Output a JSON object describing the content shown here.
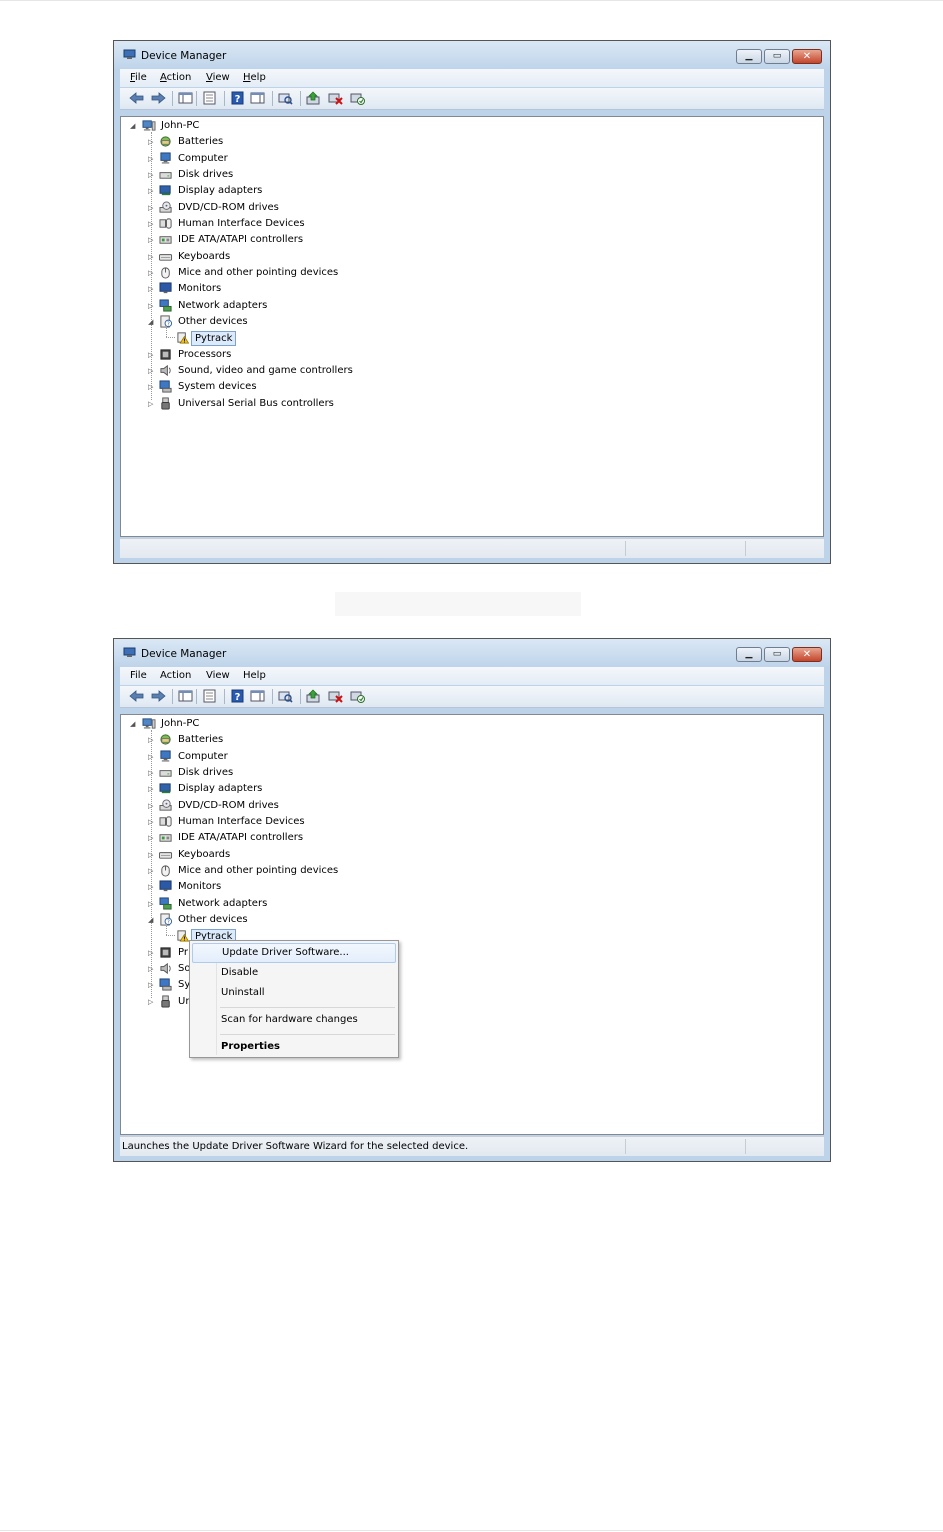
{
  "app": {
    "title": "Device Manager"
  },
  "menu": [
    {
      "label": "File",
      "hotkey": "F",
      "rest": "ile"
    },
    {
      "label": "Action",
      "hotkey": "A",
      "rest": "ction"
    },
    {
      "label": "View",
      "hotkey": "V",
      "rest": "iew"
    },
    {
      "label": "Help",
      "hotkey": "H",
      "rest": "elp"
    }
  ],
  "toolbar_icons": [
    "back-arrow-icon",
    "forward-arrow-icon",
    "show-hide-console-tree-icon",
    "properties-icon",
    "help-icon",
    "action-pane-icon",
    "scan-hardware-icon",
    "update-driver-icon",
    "uninstall-icon",
    "enable-device-icon"
  ],
  "tree": {
    "root": "John-PC",
    "categories": [
      {
        "label": "Batteries",
        "icon": "battery-icon"
      },
      {
        "label": "Computer",
        "icon": "computer-icon"
      },
      {
        "label": "Disk drives",
        "icon": "disk-drive-icon"
      },
      {
        "label": "Display adapters",
        "icon": "display-adapter-icon"
      },
      {
        "label": "DVD/CD-ROM drives",
        "icon": "dvd-drive-icon"
      },
      {
        "label": "Human Interface Devices",
        "icon": "hid-icon"
      },
      {
        "label": "IDE ATA/ATAPI controllers",
        "icon": "ide-controller-icon"
      },
      {
        "label": "Keyboards",
        "icon": "keyboard-icon"
      },
      {
        "label": "Mice and other pointing devices",
        "icon": "mouse-icon"
      },
      {
        "label": "Monitors",
        "icon": "monitor-icon"
      },
      {
        "label": "Network adapters",
        "icon": "network-adapter-icon"
      },
      {
        "label": "Other devices",
        "icon": "other-devices-icon",
        "expanded": true,
        "children": [
          {
            "label": "Pytrack",
            "icon": "warning-device-icon"
          }
        ]
      },
      {
        "label": "Processors",
        "icon": "processor-icon"
      },
      {
        "label": "Sound, video and game controllers",
        "icon": "sound-icon"
      },
      {
        "label": "System devices",
        "icon": "system-devices-icon"
      },
      {
        "label": "Universal Serial Bus controllers",
        "icon": "usb-icon"
      }
    ],
    "truncated_after_menu": [
      "Pr",
      "So",
      "Sy",
      "Ur"
    ]
  },
  "context_menu": {
    "items": [
      {
        "label": "Update Driver Software...",
        "highlighted": true
      },
      {
        "label": "Disable"
      },
      {
        "label": "Uninstall"
      },
      {
        "label": "Scan for hardware changes"
      },
      {
        "label": "Properties",
        "bold": true
      }
    ]
  },
  "status": {
    "window1": "",
    "window2": "Launches the Update Driver Software Wizard for the selected device."
  }
}
